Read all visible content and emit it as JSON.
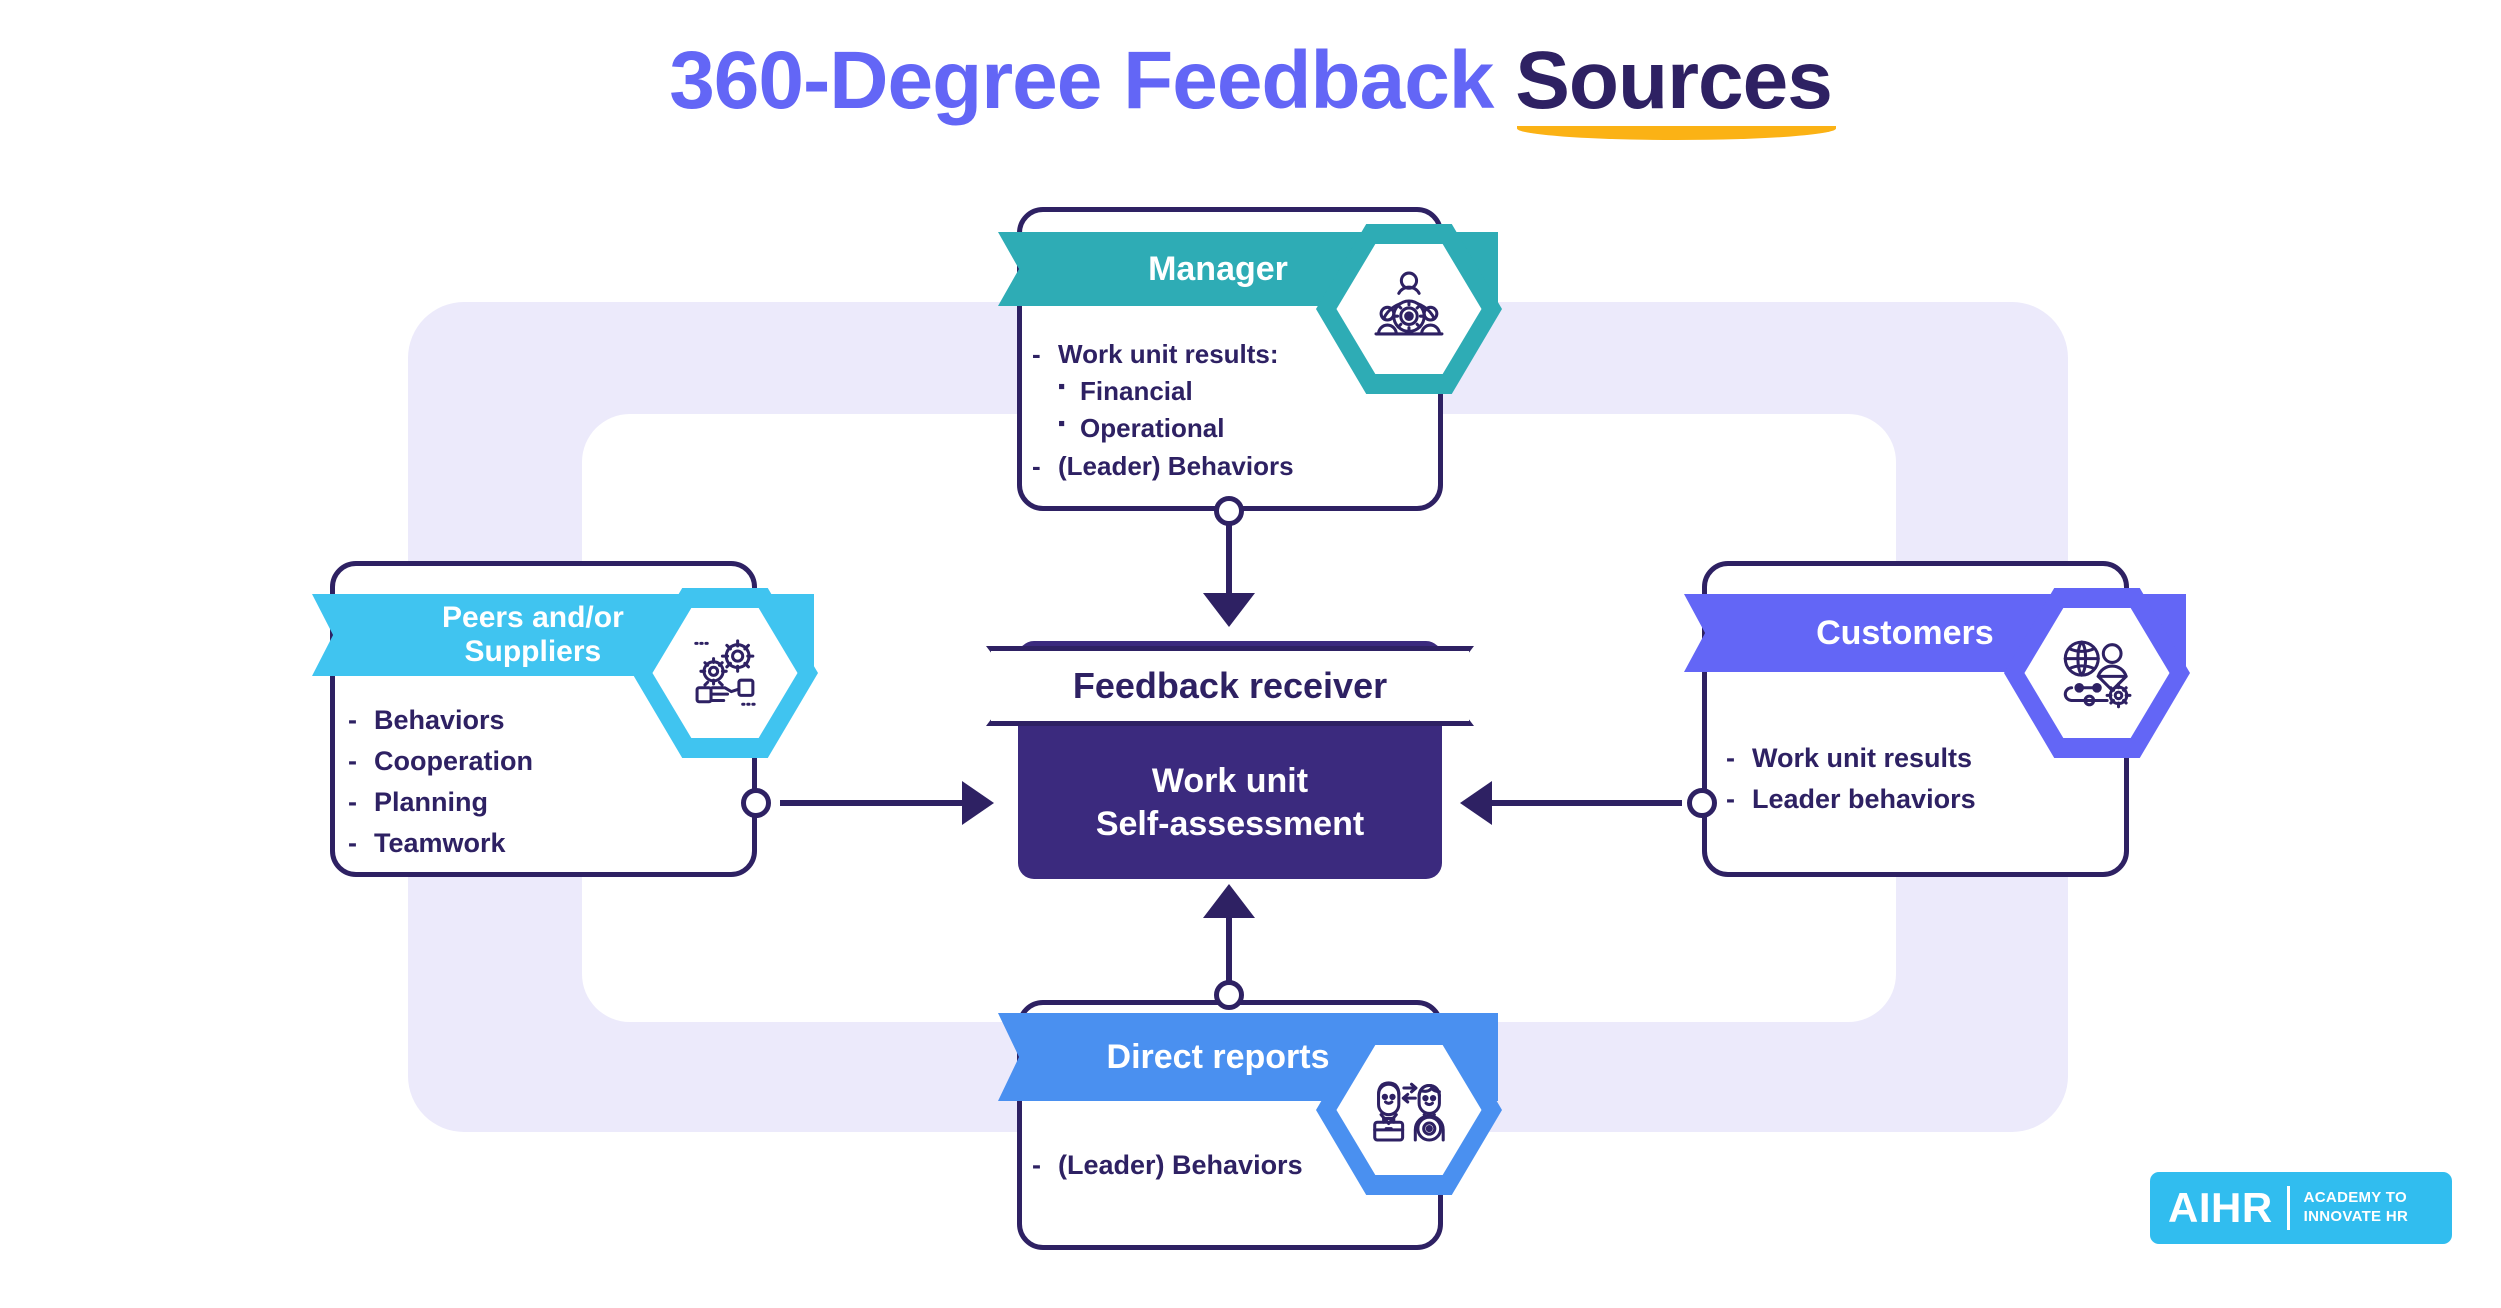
{
  "title": {
    "part_primary": "360-Degree Feedback ",
    "part_accent": "Sources",
    "color_primary": "#6366f6",
    "color_accent": "#2e2163",
    "underline_color": "#fbb215"
  },
  "center": {
    "ribbon_label": "Feedback receiver",
    "line1": "Work unit",
    "line2": "Self-assessment",
    "fill_color": "#3b2a7e"
  },
  "sources": {
    "manager": {
      "label": "Manager",
      "color": "#2eacb5",
      "icon": "team-gear-icon",
      "items": [
        {
          "text": "Work unit results:",
          "level": 1,
          "marker": "-"
        },
        {
          "text": "Financial",
          "level": 2,
          "marker": "▪"
        },
        {
          "text": "Operational",
          "level": 2,
          "marker": "▪"
        },
        {
          "text": "(Leader) Behaviors",
          "level": 1,
          "marker": "-"
        }
      ]
    },
    "peers": {
      "label": "Peers and/or\nSuppliers",
      "label_line1": "Peers and/or",
      "label_line2": "Suppliers",
      "color": "#40c4f0",
      "icon": "gears-handshake-icon",
      "items": [
        {
          "text": "Behaviors",
          "level": 1,
          "marker": "-"
        },
        {
          "text": "Cooperation",
          "level": 1,
          "marker": "-"
        },
        {
          "text": "Planning",
          "level": 1,
          "marker": "-"
        },
        {
          "text": "Teamwork",
          "level": 1,
          "marker": "-"
        }
      ]
    },
    "customers": {
      "label": "Customers",
      "color": "#6366f6",
      "icon": "globe-customer-gear-icon",
      "items": [
        {
          "text": "Work unit results",
          "level": 1,
          "marker": "-"
        },
        {
          "text": "Leader behaviors",
          "level": 1,
          "marker": "-"
        }
      ]
    },
    "direct_reports": {
      "label": "Direct reports",
      "color": "#4a90f0",
      "icon": "two-people-exchange-icon",
      "items": [
        {
          "text": "(Leader) Behaviors",
          "level": 1,
          "marker": "-"
        }
      ]
    }
  },
  "logo": {
    "mark": "AIHR",
    "tagline_line1": "ACADEMY TO",
    "tagline_line2": "INNOVATE HR",
    "background": "#31bdef"
  },
  "theme": {
    "ink": "#2e2163",
    "bg_panel": "#eceafb",
    "white": "#ffffff"
  }
}
